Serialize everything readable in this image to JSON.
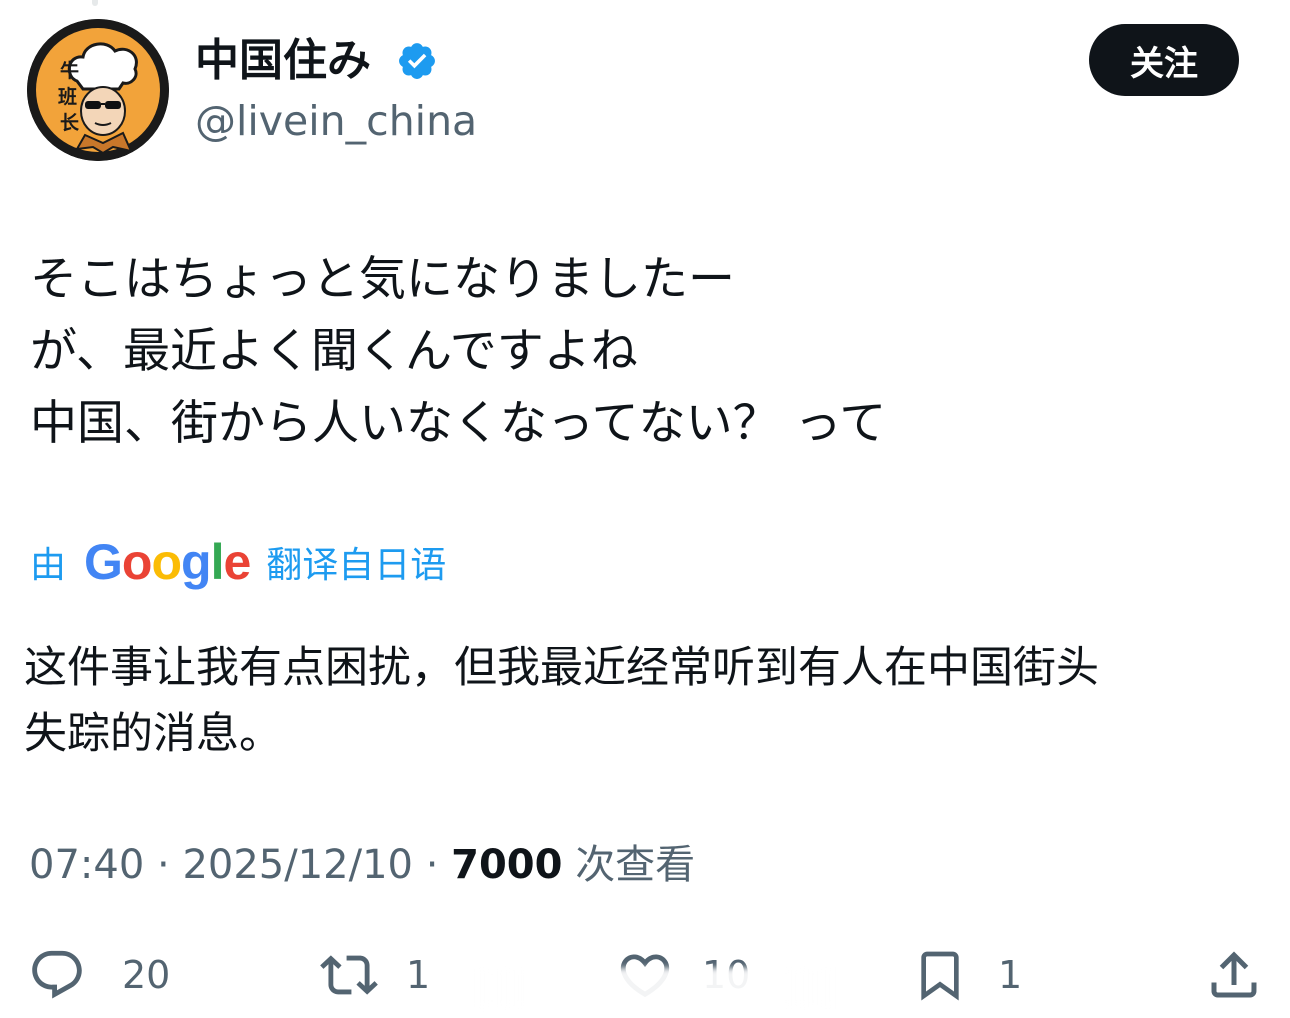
{
  "author": {
    "display_name": "中国住み",
    "handle": "@livein_china",
    "verified": true,
    "avatar_text": "牛班长",
    "avatar_colors": {
      "ring": "#1a1a1a",
      "background": "#f2a33a",
      "hat": "#ffffff"
    }
  },
  "header": {
    "follow_label": "关注"
  },
  "post": {
    "original_lines": [
      "そこはちょっと気になりましたー",
      "が、最近よく聞くんですよね",
      "中国、街から人いなくなってない？ って"
    ],
    "translation": {
      "prefix": "由",
      "provider": "Google",
      "suffix": "翻译自日语",
      "lines": [
        "这件事让我有点困扰，但我最近经常听到有人在中国街头",
        "失踪的消息。"
      ]
    }
  },
  "meta": {
    "time": "07:40",
    "date": "2025/12/10",
    "views_count": "7000",
    "views_label": "次查看",
    "separator": "·"
  },
  "actions": {
    "reply": {
      "icon": "reply-icon",
      "count": "20"
    },
    "repost": {
      "icon": "repost-icon",
      "count": "1"
    },
    "like": {
      "icon": "like-icon",
      "count": "10"
    },
    "bookmark": {
      "icon": "bookmark-icon",
      "count": "1"
    },
    "share": {
      "icon": "share-icon"
    }
  },
  "colors": {
    "text": "#0f1419",
    "secondary": "#536471",
    "link": "#1d9bf0",
    "follow_bg": "#0f1419",
    "google": [
      "#4285F4",
      "#EA4335",
      "#FBBC05",
      "#4285F4",
      "#34A853",
      "#EA4335"
    ]
  }
}
